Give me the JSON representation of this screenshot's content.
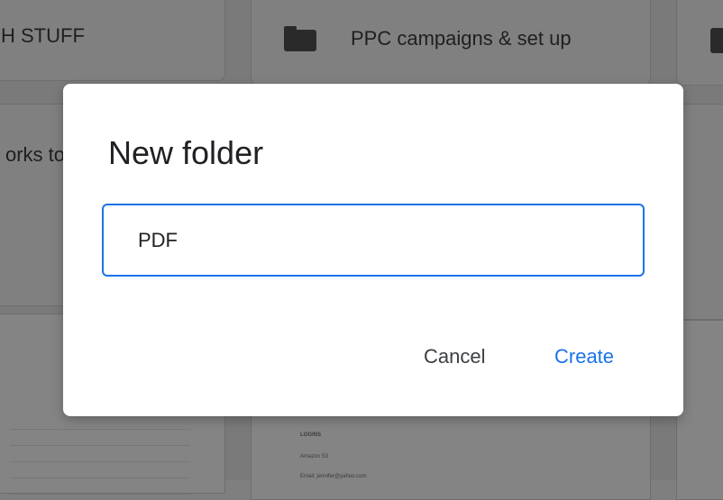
{
  "background": {
    "folders": [
      {
        "label": "H STUFF"
      },
      {
        "label": "PPC campaigns & set up"
      }
    ],
    "partial_text": "orks to",
    "doc_preview": {
      "heading": "LOGINS",
      "line1": "Amazon S3",
      "line2": "Email: jennifer@yahoo.com"
    }
  },
  "dialog": {
    "title": "New folder",
    "input_value": "PDF",
    "cancel_label": "Cancel",
    "create_label": "Create"
  },
  "colors": {
    "accent": "#1a73e8",
    "title_text": "#202124",
    "secondary_text": "#3c4043",
    "scrim": "#7a7a7a"
  }
}
